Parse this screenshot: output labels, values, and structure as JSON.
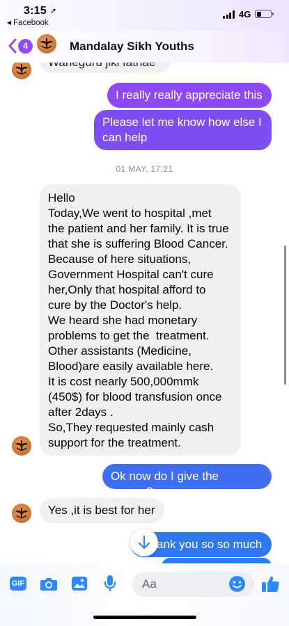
{
  "status_bar": {
    "time": "3:15",
    "back_app": "Facebook",
    "network": "4G"
  },
  "header": {
    "unread_count": "4",
    "title": "Mandalay Sikh Youths"
  },
  "messages": {
    "partial_top": "Waheguru jiki fathae",
    "out_1": "I really really appreciate this",
    "out_2": "Please let me know how else I can help",
    "timestamp": "01 MAY, 17:21",
    "in_long": [
      "Hello",
      "Today,We went to hospital ,met",
      "the patient and her family. It is true",
      "that she is suffering Blood Cancer.",
      "Because of here situations,",
      "Government Hospital can't cure",
      "her,Only that hospital afford to",
      "cure by the Doctor's help.",
      "We heard she had monetary",
      "problems to get the  treatment.",
      "Other assistants (Medicine,",
      "Blood)are easily available here.",
      "It is cost nearly 500,000mmk",
      "(450$) for blood transfusion once",
      "after 2days .",
      "So,They requested mainly cash",
      "support for the treatment."
    ],
    "out_3": "Ok now do I give the money?",
    "in_short": "Yes ,it is best for her",
    "out_4_partial": "ank you so so much"
  },
  "composer": {
    "gif_label": "GIF",
    "placeholder": "Aa"
  },
  "colors": {
    "bubble_purple": "#8a4cf5",
    "bubble_blue": "#3b6ff0",
    "incoming_bg": "#f0f0f0",
    "accent": "#2e89ff"
  }
}
